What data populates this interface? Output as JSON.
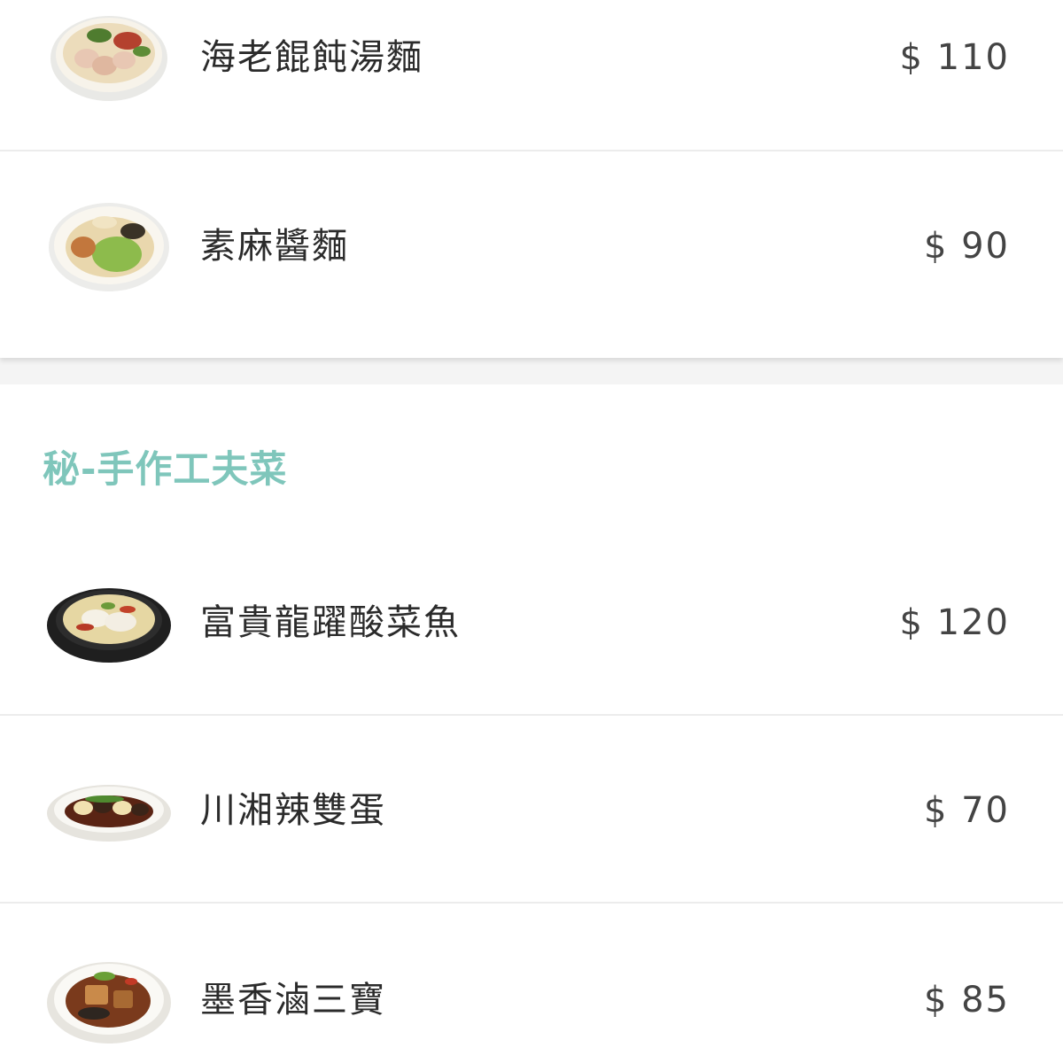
{
  "theme": {
    "accent": "#7fc6bb",
    "background": "#f4f4f4",
    "card": "#ffffff",
    "text": "#2b2b2b",
    "price_text": "#444444"
  },
  "top_section": {
    "items": [
      {
        "name": "海老餛飩湯麵",
        "price": "$ 110",
        "image": "wonton-noodle-soup-bowl"
      },
      {
        "name": "素麻醬麵",
        "price": "$ 90",
        "image": "sesame-sauce-noodles-plate"
      }
    ]
  },
  "section": {
    "title": "秘-手作工夫菜",
    "items": [
      {
        "name": "富貴龍躍酸菜魚",
        "price": "$ 120",
        "image": "pickled-cabbage-fish-hotpot"
      },
      {
        "name": "川湘辣雙蛋",
        "price": "$ 70",
        "image": "spicy-double-eggs-dish"
      },
      {
        "name": "墨香滷三寶",
        "price": "$ 85",
        "image": "braised-three-treasures-plate"
      }
    ]
  }
}
